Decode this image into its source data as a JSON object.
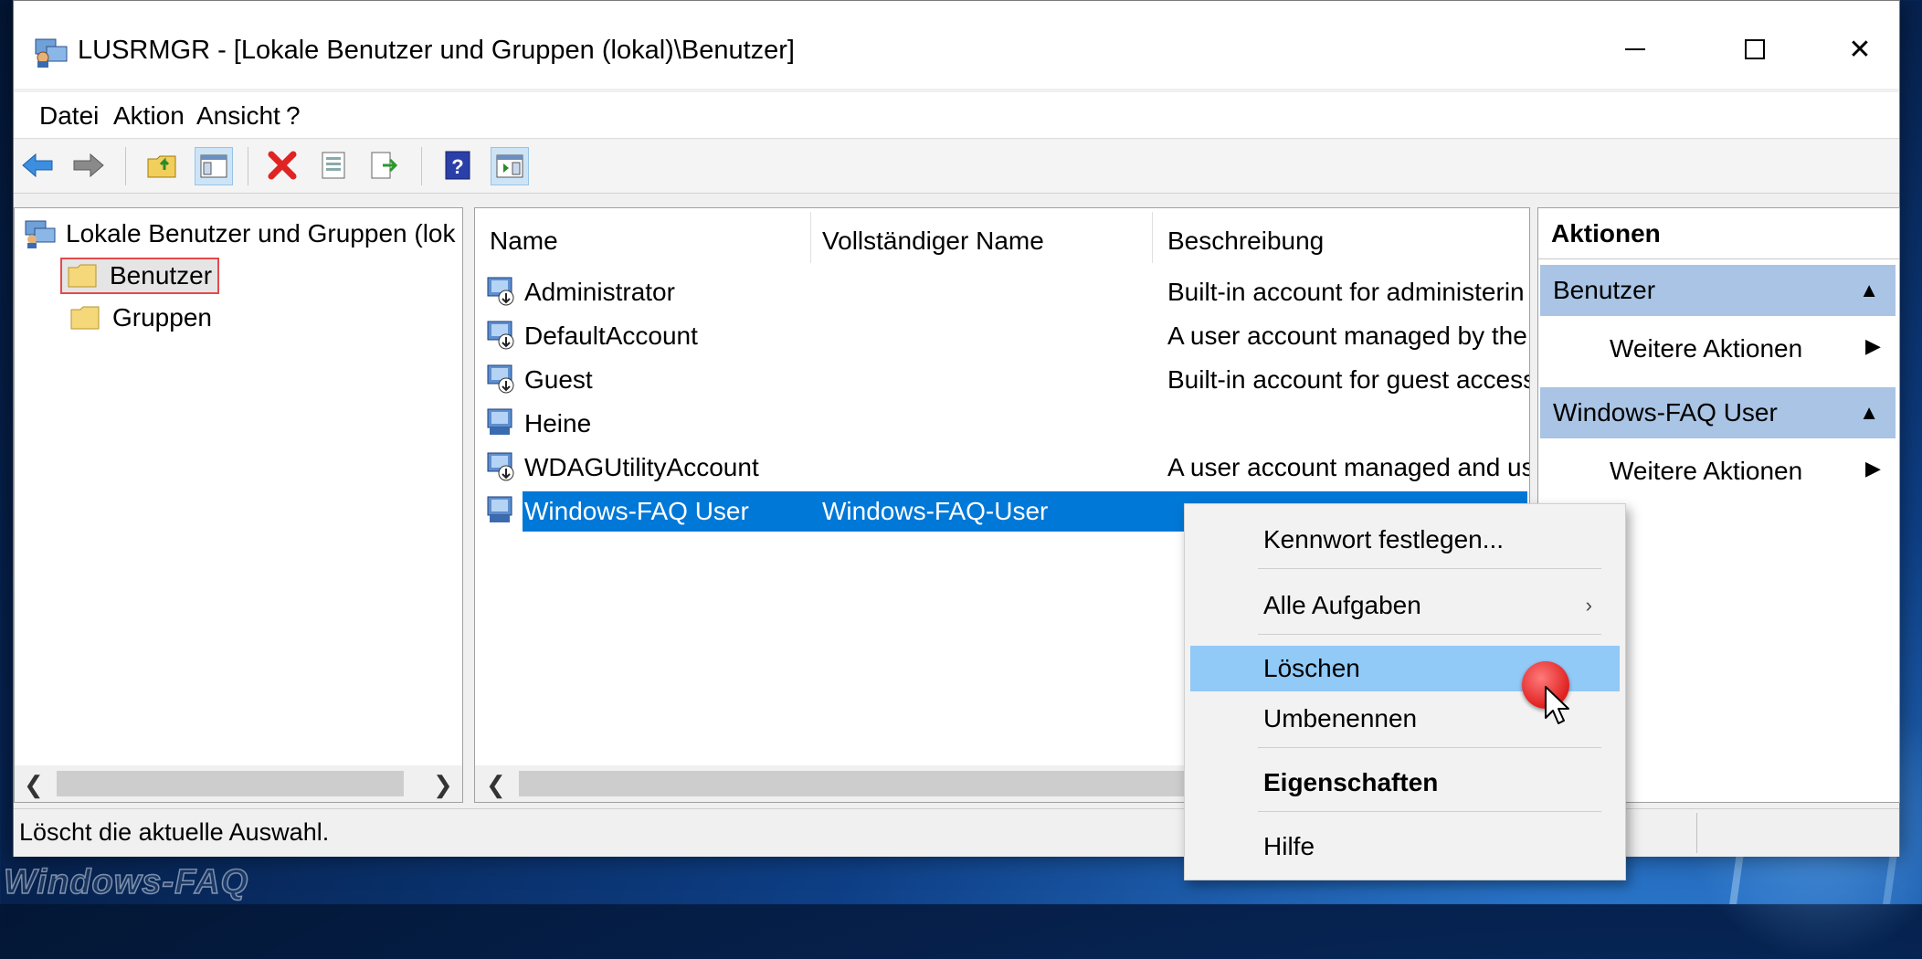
{
  "window": {
    "title": "LUSRMGR - [Lokale Benutzer und Gruppen (lokal)\\Benutzer]"
  },
  "menu": [
    "Datei",
    "Aktion",
    "Ansicht",
    "?"
  ],
  "toolbar": {
    "icons": [
      "back-arrow-icon",
      "forward-arrow-icon",
      "up-folder-icon",
      "show-hide-tree-icon",
      "delete-icon",
      "properties-icon",
      "export-list-icon",
      "help-icon",
      "show-hide-action-pane-icon"
    ]
  },
  "tree": {
    "root": "Lokale Benutzer und Gruppen (lok",
    "items": [
      {
        "label": "Benutzer"
      },
      {
        "label": "Gruppen"
      }
    ]
  },
  "list": {
    "columns": [
      "Name",
      "Vollständiger Name",
      "Beschreibung"
    ],
    "rows": [
      {
        "name": "Administrator",
        "fullname": "",
        "description": "Built-in account for administerin"
      },
      {
        "name": "DefaultAccount",
        "fullname": "",
        "description": "A user account managed by the"
      },
      {
        "name": "Guest",
        "fullname": "",
        "description": "Built-in account for guest access"
      },
      {
        "name": "Heine",
        "fullname": "",
        "description": ""
      },
      {
        "name": "WDAGUtilityAccount",
        "fullname": "",
        "description": "A user account managed and us"
      },
      {
        "name": "Windows-FAQ User",
        "fullname": "Windows-FAQ-User",
        "description": ""
      }
    ],
    "selected_row": "Windows-FAQ User"
  },
  "actions": {
    "title": "Aktionen",
    "sections": [
      {
        "header": "Benutzer",
        "link": "Weitere Aktionen"
      },
      {
        "header": "Windows-FAQ User",
        "link": "Weitere Aktionen"
      }
    ]
  },
  "context_menu": {
    "items": [
      "Kennwort festlegen...",
      "Alle Aufgaben",
      "Löschen",
      "Umbenennen",
      "Eigenschaften",
      "Hilfe"
    ],
    "hovered": "Löschen",
    "bold": "Eigenschaften"
  },
  "status": {
    "text": "Löscht die aktuelle Auswahl."
  },
  "watermark": "Windows-FAQ",
  "colors": {
    "selection": "#0078d7",
    "menu_hover": "#91c9f7",
    "action_section": "#a9c4e4",
    "highlight_border": "#e34b4b"
  }
}
